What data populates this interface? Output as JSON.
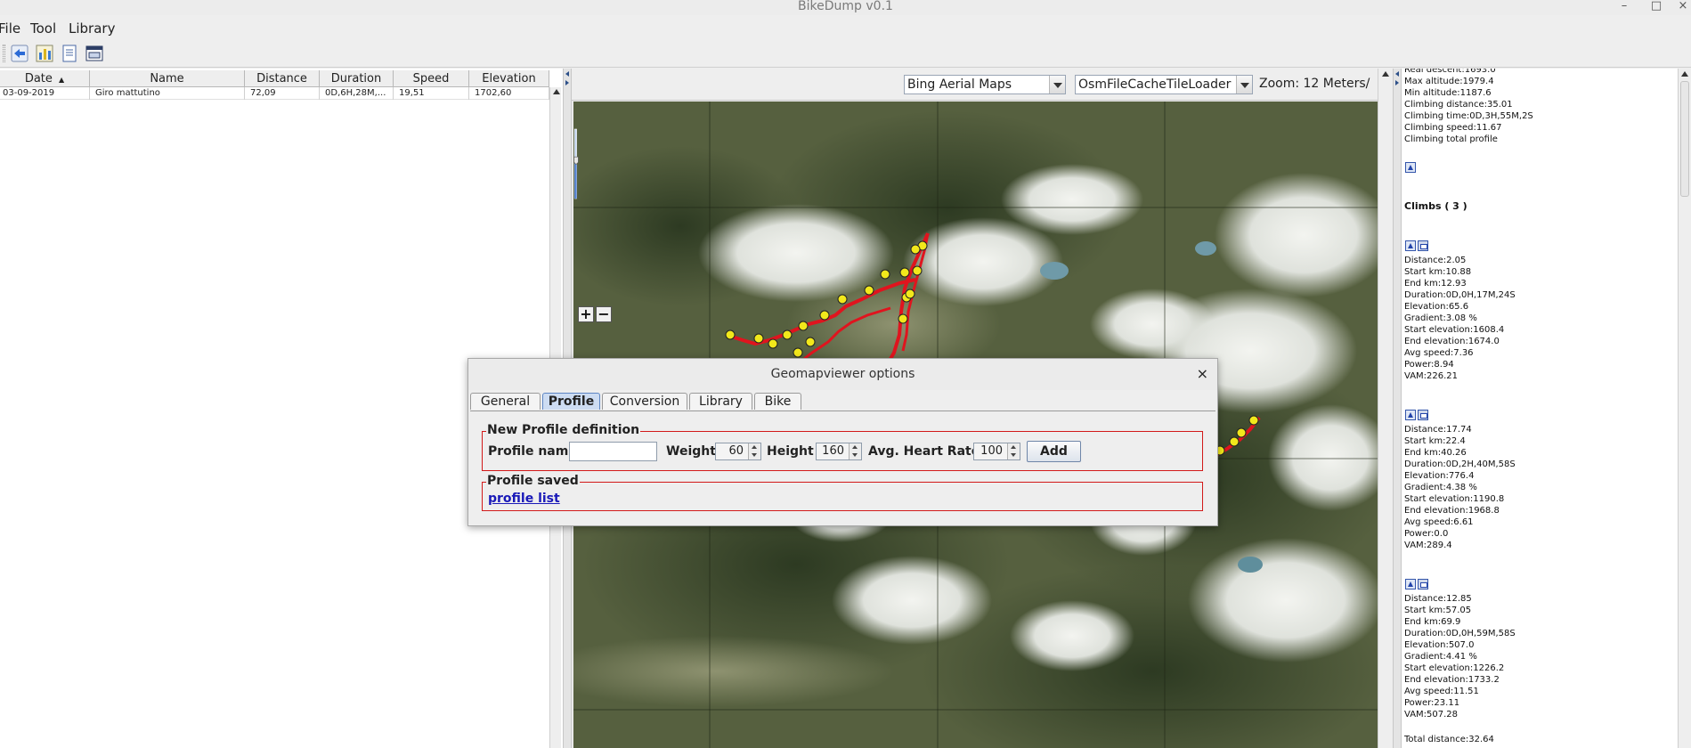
{
  "window": {
    "title": "BikeDump v0.1",
    "minimize_glyph": "–",
    "maximize_glyph": "□",
    "close_glyph": "×"
  },
  "menu": {
    "file": "File",
    "tool": "Tool",
    "library": "Library"
  },
  "toolbar": {
    "icons": [
      "back-arrow-icon",
      "chart-icon",
      "document-icon",
      "window-icon"
    ]
  },
  "table": {
    "columns": [
      "Date",
      "Name",
      "Distance",
      "Duration",
      "Speed",
      "Elevation"
    ],
    "sort_glyph": "▲",
    "rows": [
      [
        "03-09-2019",
        "Giro mattutino",
        "72,09",
        "0D,6H,28M,...",
        "19,51",
        "1702,60"
      ]
    ]
  },
  "map": {
    "source": "Bing Aerial Maps",
    "loader": "OsmFileCacheTileLoader",
    "zoom_label": "Zoom:  12 Meters/",
    "zoom_in": "+",
    "zoom_out": "−",
    "colors": {
      "track": "#e0141e",
      "marker": "#f2e81b"
    }
  },
  "stats": {
    "top": [
      "Real descent:1693.0",
      "Max altitude:1979.4",
      "Min altitude:1187.6",
      "Climbing distance:35.01",
      "Climbing time:0D,3H,55M,2S",
      "Climbing speed:11.67",
      "Climbing total profile"
    ],
    "climbs_header": "Climbs ( 3 )",
    "climb1": [
      "Distance:2.05",
      "Start km:10.88",
      "End km:12.93",
      "Duration:0D,0H,17M,24S",
      "Elevation:65.6",
      "Gradient:3.08 %",
      "Start elevation:1608.4",
      "End elevation:1674.0",
      "Avg speed:7.36",
      "Power:8.94",
      "VAM:226.21"
    ],
    "climb2": [
      "Distance:17.74",
      "Start km:22.4",
      "End km:40.26",
      "Duration:0D,2H,40M,58S",
      "Elevation:776.4",
      "Gradient:4.38 %",
      "Start elevation:1190.8",
      "End elevation:1968.8",
      "Avg speed:6.61",
      "Power:0.0",
      "VAM:289.4"
    ],
    "climb3": [
      "Distance:12.85",
      "Start km:57.05",
      "End km:69.9",
      "Duration:0D,0H,59M,58S",
      "Elevation:507.0",
      "Gradient:4.41 %",
      "Start elevation:1226.2",
      "End elevation:1733.2",
      "Avg speed:11.51",
      "Power:23.11",
      "VAM:507.28"
    ],
    "footer": "Total distance:32.64"
  },
  "dialog": {
    "title": "Geomapviewer options",
    "close_glyph": "×",
    "tabs": [
      "General",
      "Profile",
      "Conversion",
      "Library",
      "Bike"
    ],
    "active_tab": "Profile",
    "new_profile_title": "New Profile definition",
    "profile_name_label": "Profile name",
    "profile_name_value": "",
    "weight_label": "Weight",
    "weight_value": "60",
    "height_label": "Height",
    "height_value": "160",
    "hr_label": "Avg. Heart Rate",
    "hr_value": "100",
    "add_label": "Add",
    "saved_title": "Profile saved",
    "profile_list_link": "profile list",
    "colors": {
      "group_border": "#d21919",
      "link": "#1a1ab8"
    }
  }
}
